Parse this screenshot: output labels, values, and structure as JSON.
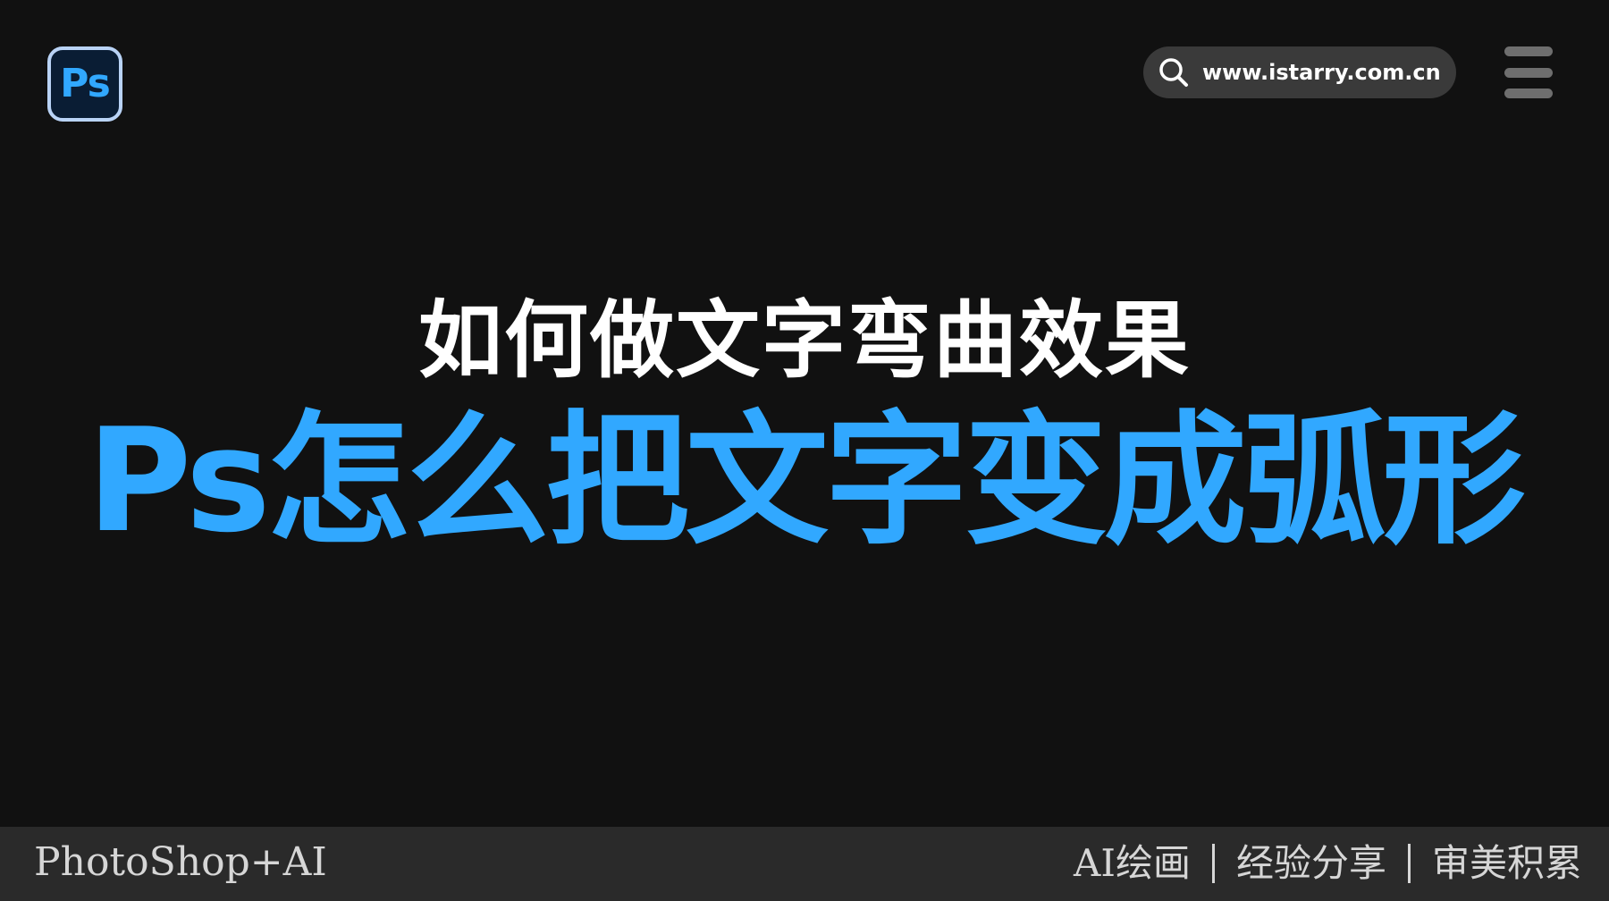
{
  "logo": {
    "text": "Ps",
    "colors": {
      "accent": "#31a8ff",
      "border": "#b9d3f6",
      "fill": "#0a1d34"
    }
  },
  "header": {
    "search": {
      "icon": "search-icon",
      "text": "www.istarry.com.cn"
    },
    "menu_icon": "hamburger-menu-icon"
  },
  "hero": {
    "subtitle": "如何做文字弯曲效果",
    "title": "Ps怎么把文字变成弧形"
  },
  "footer": {
    "left": "PhotoShop+AI",
    "tags": [
      "AI绘画",
      "经验分享",
      "审美积累"
    ]
  },
  "colors": {
    "background": "#111111",
    "footer_bg": "#2a2a2a",
    "title_blue": "#31a8ff",
    "subtitle_white": "#ffffff"
  }
}
